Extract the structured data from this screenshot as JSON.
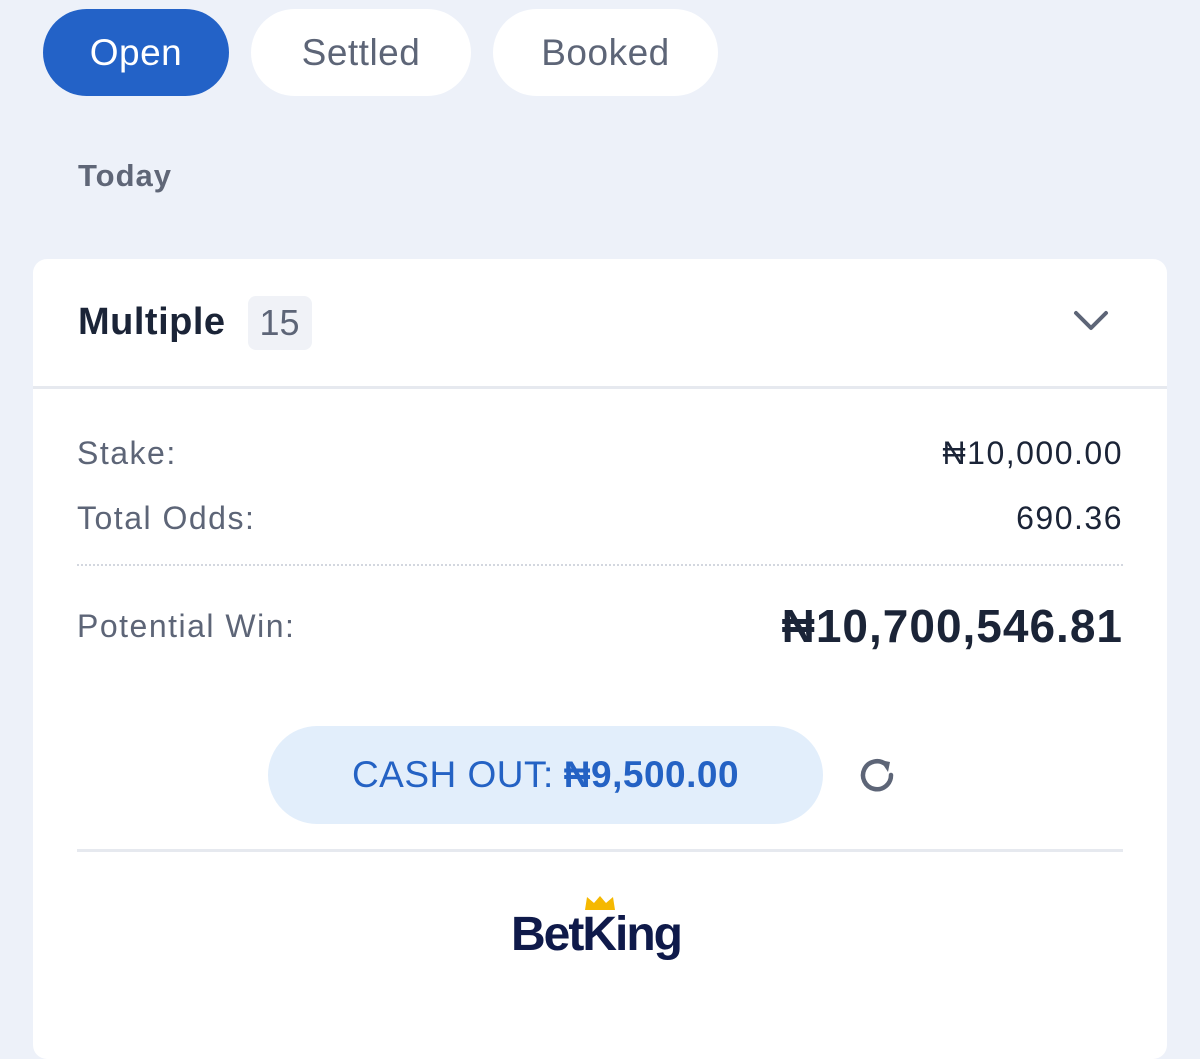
{
  "tabs": [
    {
      "label": "Open",
      "active": true
    },
    {
      "label": "Settled",
      "active": false
    },
    {
      "label": "Booked",
      "active": false
    }
  ],
  "section_label": "Today",
  "bet": {
    "type": "Multiple",
    "count": "15",
    "stake_label": "Stake:",
    "stake_value": "₦10,000.00",
    "odds_label": "Total Odds:",
    "odds_value": "690.36",
    "win_label": "Potential Win:",
    "win_value": "₦10,700,546.81"
  },
  "cashout": {
    "label": "CASH OUT:",
    "amount": "₦9,500.00"
  },
  "brand": {
    "name": "BetKing",
    "color": "#0f1a4a",
    "crown_color": "#f5b800"
  },
  "colors": {
    "accent": "#2362c7",
    "background": "#edf1f9"
  },
  "icons": {
    "expand": "chevron-down-icon",
    "refresh": "refresh-icon"
  }
}
